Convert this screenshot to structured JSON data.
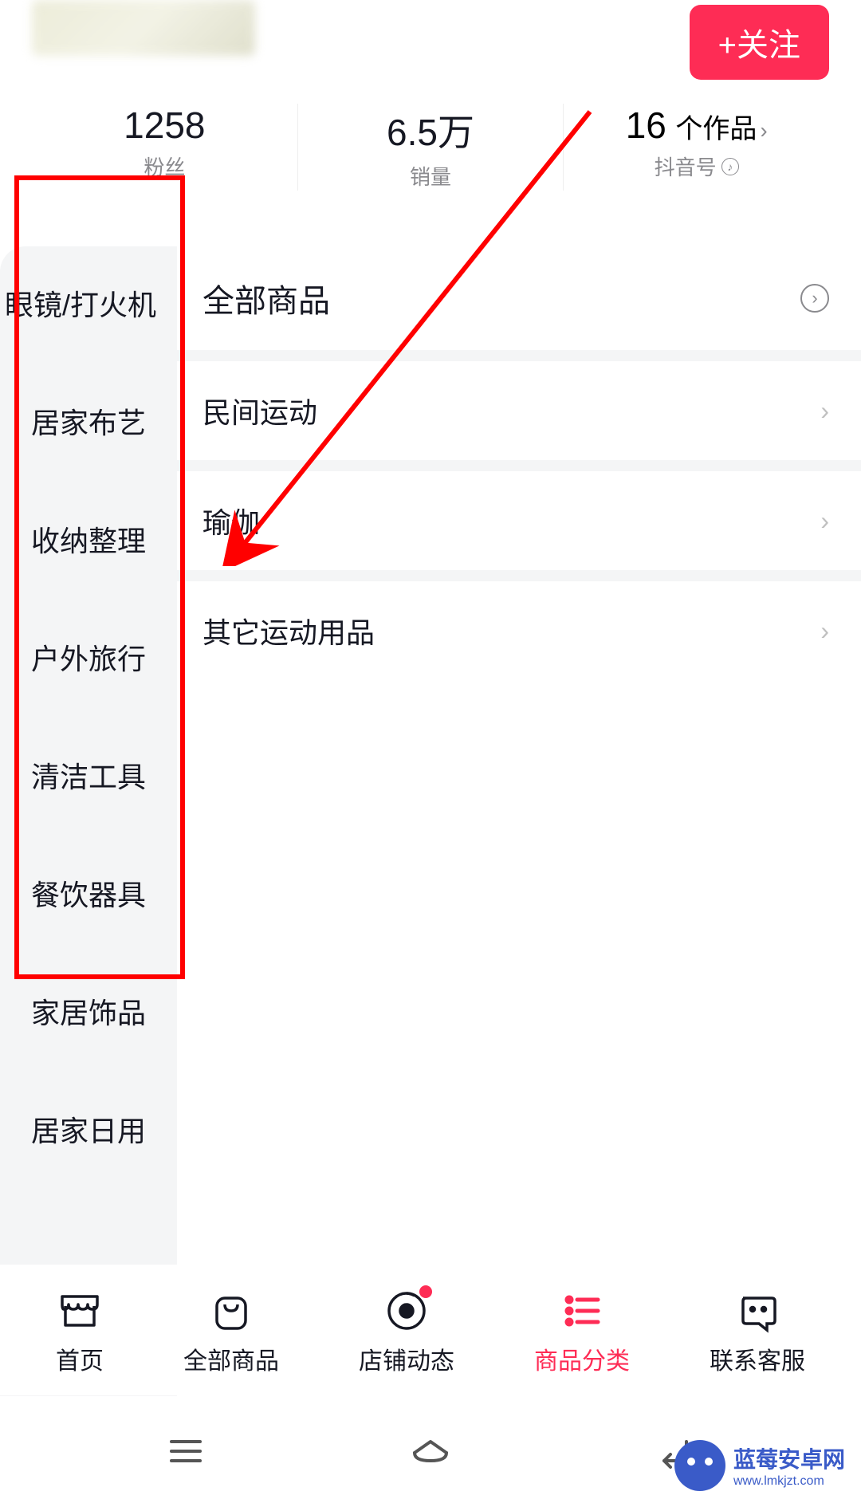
{
  "header": {
    "follow_btn": "+关注",
    "stats": [
      {
        "value": "1258",
        "label": "粉丝"
      },
      {
        "value": "6.5万",
        "label": "销量"
      },
      {
        "count": "16",
        "unit": " 个作品",
        "label": "抖音号"
      }
    ]
  },
  "sidebar": {
    "items": [
      "眼镜/打火机",
      "居家布艺",
      "收纳整理",
      "户外旅行",
      "清洁工具",
      "餐饮器具",
      "家居饰品",
      "居家日用"
    ]
  },
  "main": {
    "section_title": "全部商品",
    "categories": [
      "民间运动",
      "瑜伽",
      "其它运动用品"
    ]
  },
  "nav": {
    "items": [
      {
        "label": "首页"
      },
      {
        "label": "全部商品"
      },
      {
        "label": "店铺动态"
      },
      {
        "label": "商品分类"
      },
      {
        "label": "联系客服"
      }
    ]
  },
  "watermark": {
    "title": "蓝莓安卓网",
    "sub": "www.lmkjzt.com"
  }
}
